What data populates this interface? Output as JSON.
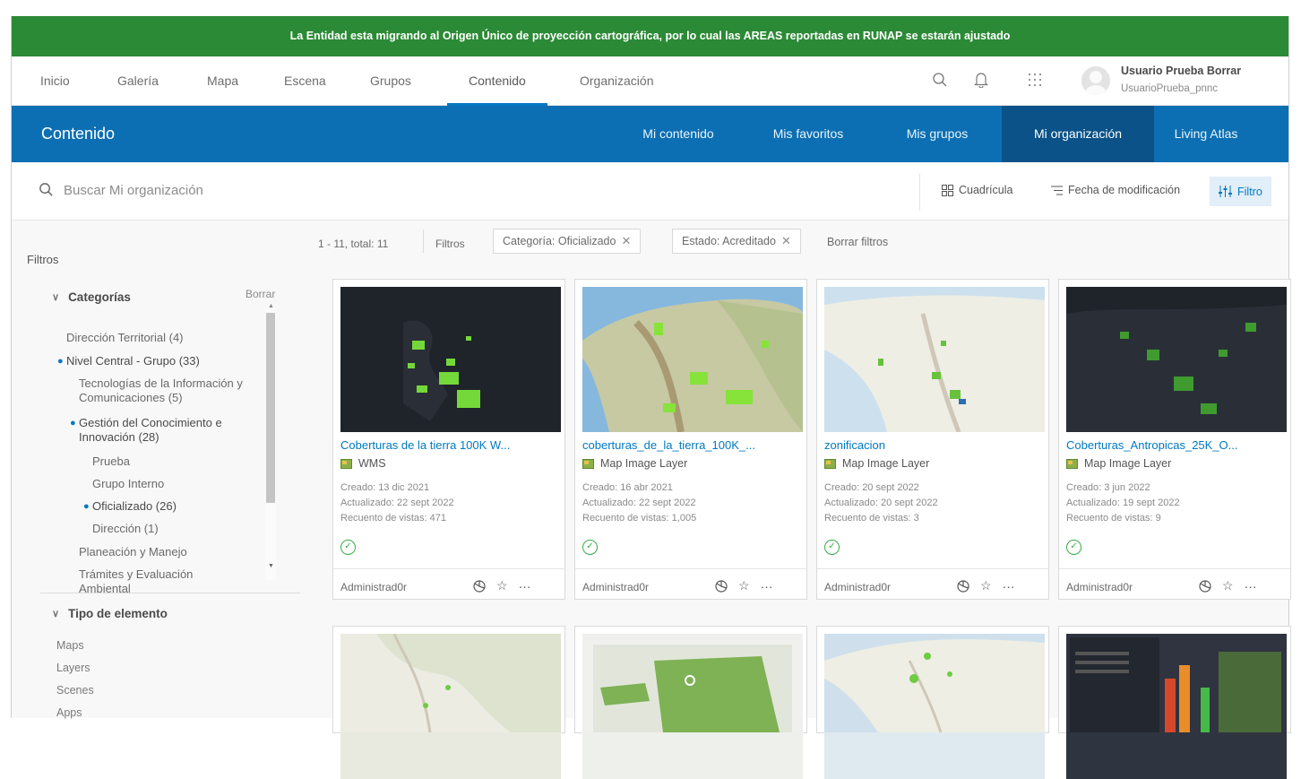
{
  "banner": {
    "text": "La Entidad esta migrando al Origen Único de proyección cartográfica, por lo cual las AREAS reportadas en RUNAP se estarán ajustado"
  },
  "topnav": {
    "items": [
      {
        "label": "Inicio"
      },
      {
        "label": "Galería"
      },
      {
        "label": "Mapa"
      },
      {
        "label": "Escena"
      },
      {
        "label": "Grupos"
      },
      {
        "label": "Contenido",
        "active": true
      },
      {
        "label": "Organización"
      }
    ],
    "icons": [
      "search-icon",
      "bell-icon",
      "apps-grid-icon"
    ],
    "user": {
      "name": "Usuario Prueba Borrar",
      "login": "UsuarioPrueba_pnnc"
    }
  },
  "content_header": {
    "title": "Contenido",
    "tabs": [
      {
        "label": "Mi contenido"
      },
      {
        "label": "Mis favoritos"
      },
      {
        "label": "Mis grupos"
      },
      {
        "label": "Mi organización",
        "active": true
      },
      {
        "label": "Living Atlas"
      }
    ]
  },
  "search": {
    "placeholder": "Buscar Mi organización"
  },
  "toolbar": {
    "grid_label": "Cuadrícula",
    "sort_label": "Fecha de modificación",
    "filter_label": "Filtro"
  },
  "sidebar": {
    "title": "Filtros",
    "categories": {
      "title": "Categorías",
      "clear": "Borrar",
      "items": [
        {
          "label": "Dirección Territorial  (4)"
        },
        {
          "label": "Nivel Central - Grupo  (33)"
        },
        {
          "label": "Tecnologías de la Información y"
        },
        {
          "label": "Comunicaciones  (5)"
        },
        {
          "label": "Gestión del Conocimiento e"
        },
        {
          "label": "Innovación  (28)"
        },
        {
          "label": "Prueba"
        },
        {
          "label": "Grupo Interno"
        },
        {
          "label": "Oficializado  (26)"
        },
        {
          "label": "Dirección  (1)"
        },
        {
          "label": "Planeación y Manejo"
        },
        {
          "label": "Trámites y Evaluación"
        },
        {
          "label": "Ambiental"
        }
      ]
    },
    "types": {
      "title": "Tipo de elemento",
      "items": [
        {
          "label": "Maps"
        },
        {
          "label": "Layers"
        },
        {
          "label": "Scenes"
        },
        {
          "label": "Apps"
        }
      ]
    }
  },
  "results": {
    "count": "1 - 11, total: 11",
    "filters_label": "Filtros",
    "chips": [
      {
        "label": "Categoría: Oficializado"
      },
      {
        "label": "Estado: Acreditado"
      }
    ],
    "clear_label": "Borrar filtros"
  },
  "cards": [
    {
      "title": "Coberturas de la tierra 100K W...",
      "type": "WMS",
      "created": "Creado: 13 dic 2021",
      "updated": "Actualizado: 22 sept 2022",
      "views": "Recuento de vistas: 471",
      "owner": "Administrad0r",
      "thumb": "dark"
    },
    {
      "title": "coberturas_de_la_tierra_100K_...",
      "type": "Map Image Layer",
      "created": "Creado: 16 abr 2021",
      "updated": "Actualizado: 22 sept 2022",
      "views": "Recuento de vistas: 1,005",
      "owner": "Administrad0r",
      "thumb": "terrain"
    },
    {
      "title": "zonificacion",
      "type": "Map Image Layer",
      "created": "Creado: 20 sept 2022",
      "updated": "Actualizado: 20 sept 2022",
      "views": "Recuento de vistas: 3",
      "owner": "Administrad0r",
      "thumb": "light"
    },
    {
      "title": "Coberturas_Antropicas_25K_O...",
      "type": "Map Image Layer",
      "created": "Creado: 3 jun 2022",
      "updated": "Actualizado: 19 sept 2022",
      "views": "Recuento de vistas: 9",
      "owner": "Administrad0r",
      "thumb": "dark"
    }
  ],
  "colors": {
    "banner": "#2b8a35",
    "header_blue": "#0c6fb3",
    "active_tab": "#0a5288",
    "link": "#0079c1"
  }
}
